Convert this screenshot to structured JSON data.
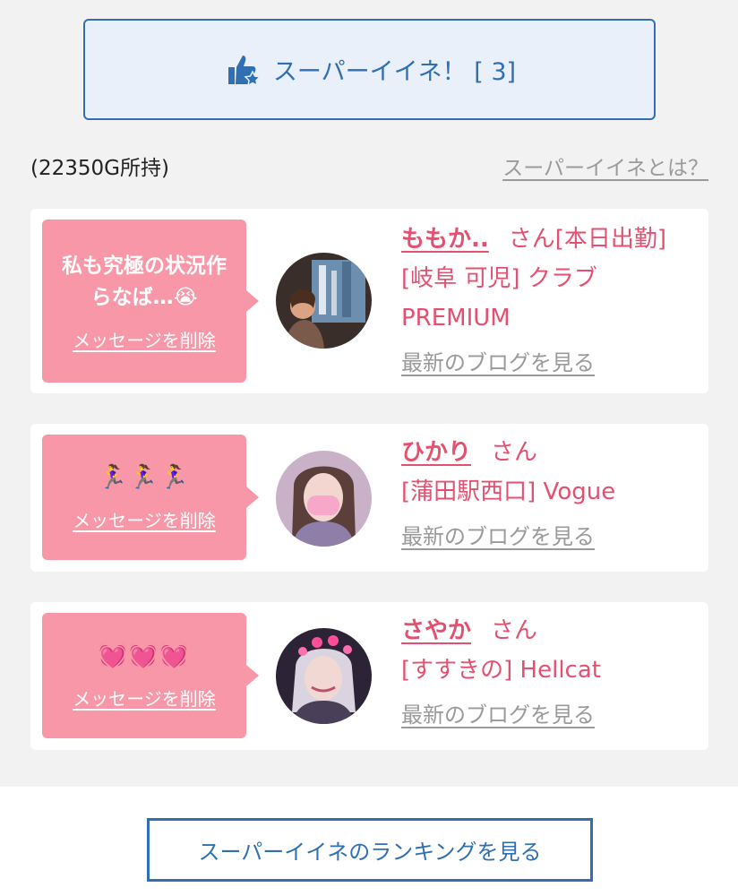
{
  "super_like": {
    "label": "スーパーイイネ！ [ 3]"
  },
  "owned": "(22350G所持)",
  "about_link": "スーパーイイネとは？",
  "delete_label": "メッセージを削除",
  "blog_label": "最新のブログを見る",
  "cards": [
    {
      "message": "私も究極の状況作らなば…😭",
      "name": "ももか..",
      "san": "さん[本日出勤]",
      "shop": "[岐阜 可児] クラブPREMIUM"
    },
    {
      "message": "🏃‍♀️🏃‍♀️🏃‍♀️",
      "name": "ひかり",
      "san": "さん",
      "shop": "[蒲田駅西口] Vogue"
    },
    {
      "message": "💓💓💓",
      "name": "さやか",
      "san": "さん",
      "shop": "[すすきの] Hellcat"
    }
  ],
  "ranking_button": "スーパーイイネのランキングを見る",
  "colors": {
    "accent_blue": "#2f6fb2",
    "pink": "#f797a7",
    "name_pink": "#e4506f"
  },
  "icons": {
    "super_like": "thumbs-up-star-icon"
  }
}
